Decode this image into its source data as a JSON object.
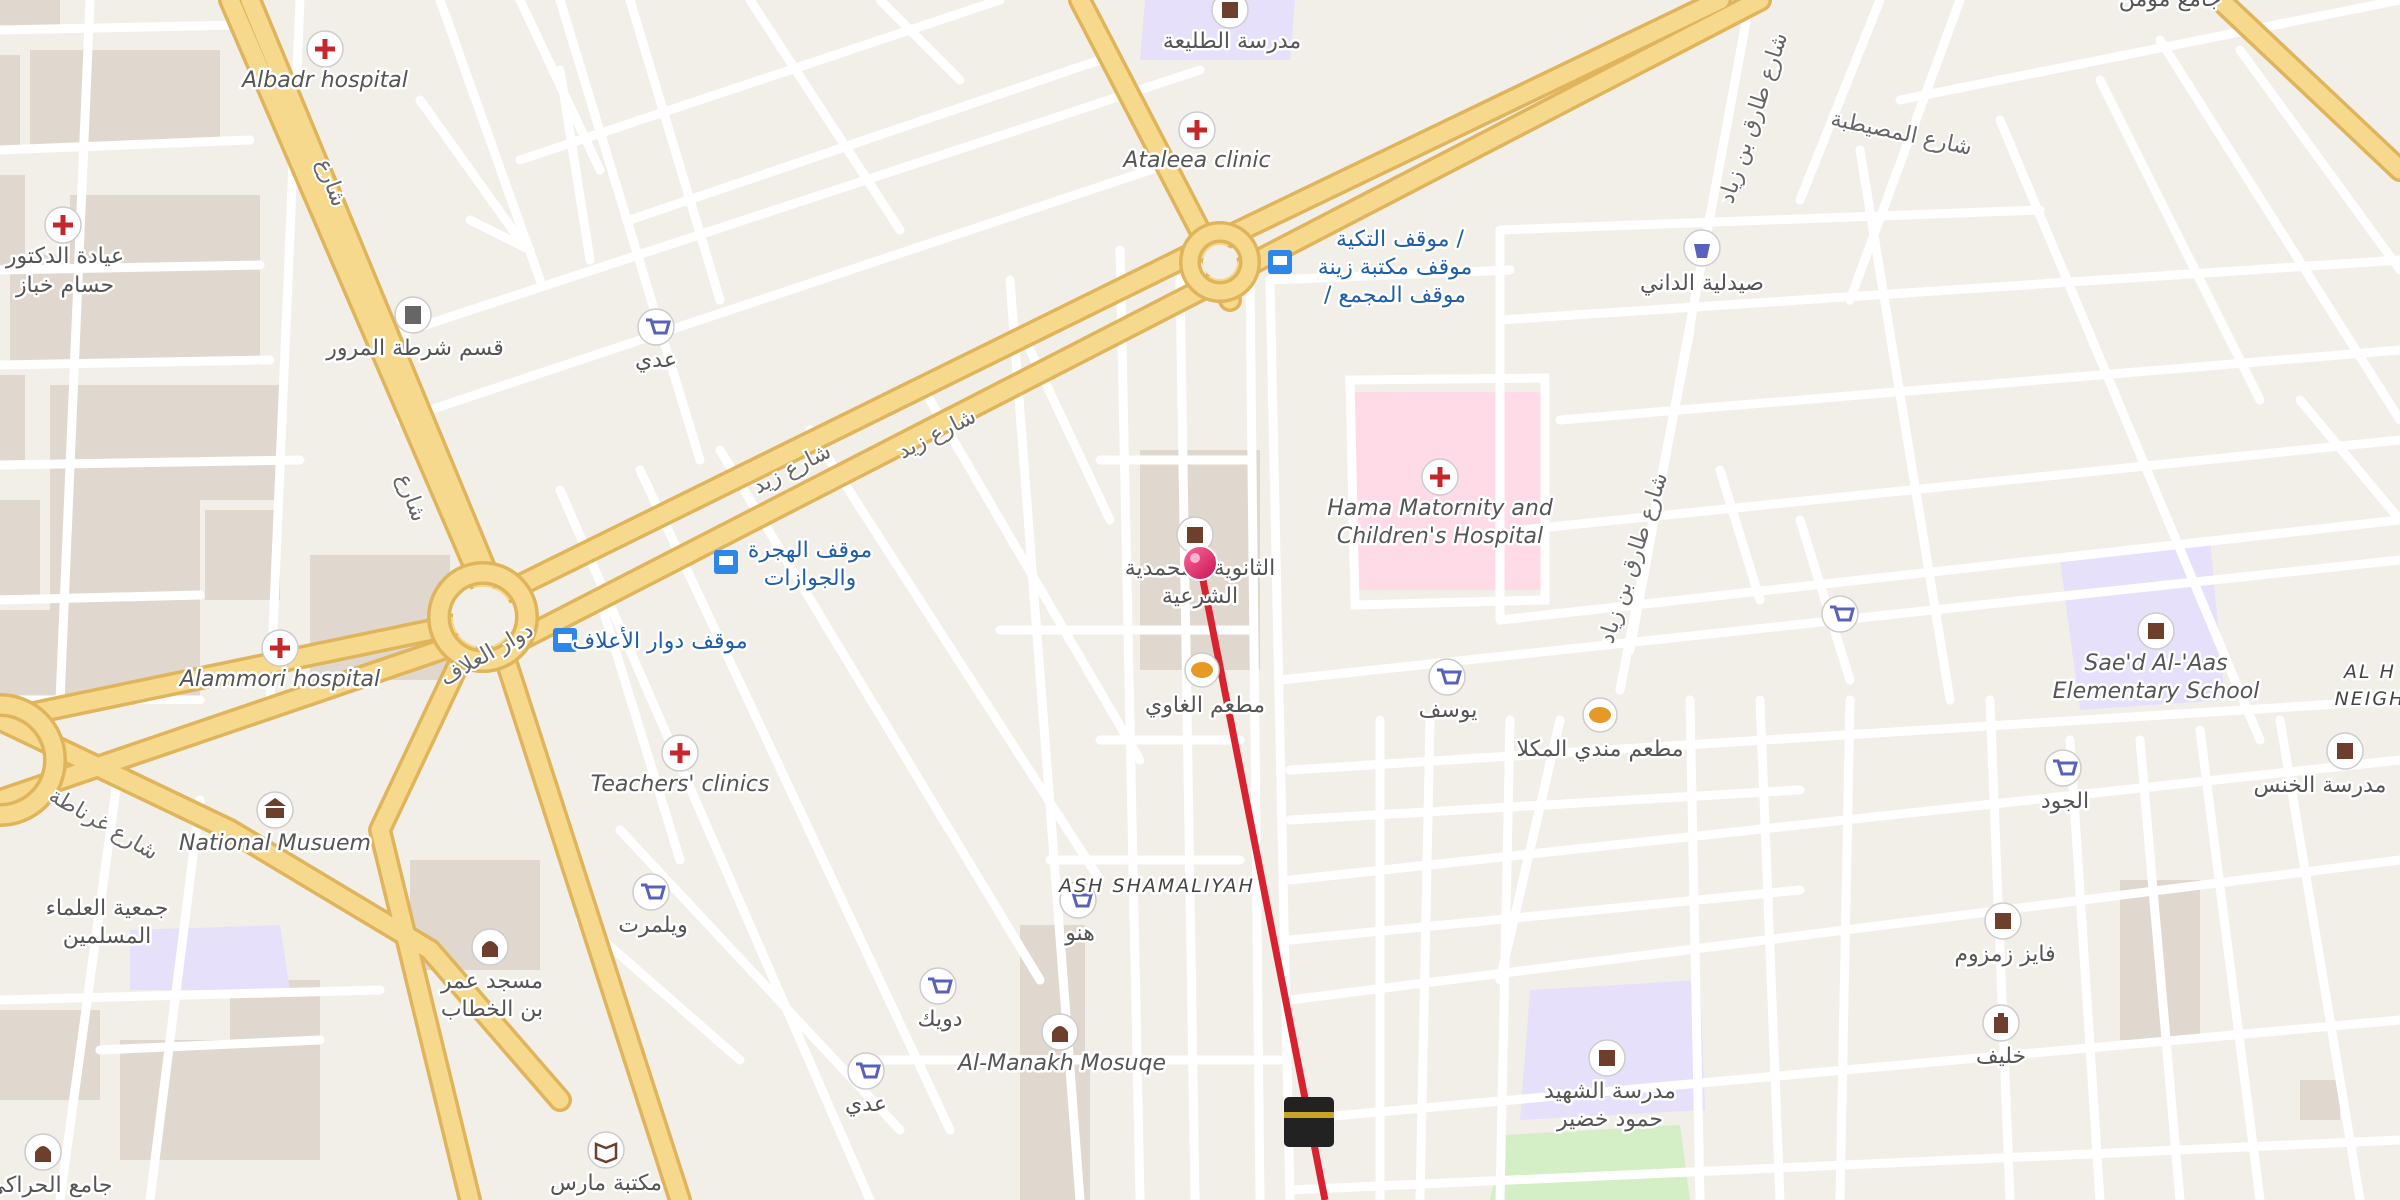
{
  "colors": {
    "land": "#f2efe9",
    "building": "#e0d8ce",
    "street": "#ffffff",
    "street_casing": "#dcd6cf",
    "major_road": "#f7d98e",
    "major_casing": "#e0b45a",
    "hospital_area": "#ffdbe8",
    "school_area": "#e6e0fb",
    "park": "#d4eec6",
    "route": "#d9222f",
    "pin": "#e91e63",
    "health_icon": "#c5282c",
    "shop_icon": "#5a61bc",
    "transit_icon": "#2d87e8",
    "food_icon": "#e69a25"
  },
  "pois": [
    {
      "icon": "hospital-cross-icon",
      "label": "Albadr hospital"
    },
    {
      "icon": "hospital-cross-icon",
      "label": "عيادة الدكتور\nحسام خباز"
    },
    {
      "icon": "police-icon",
      "label": "قسم شرطة المرور"
    },
    {
      "icon": "shop-cart-icon",
      "label": "عدي"
    },
    {
      "icon": "school-icon",
      "label": "مدرسة الطليعة"
    },
    {
      "icon": "hospital-cross-icon",
      "label": "Ataleea clinic"
    },
    {
      "icon": "bus-stop-icon",
      "label": "موقف التكية /\nموقف مكتبة زينة\n/ موقف المجمع"
    },
    {
      "icon": "pharmacy-icon",
      "label": "صيدلية الداني"
    },
    {
      "icon": "hospital-cross-icon",
      "label": "Hama Matornity and\nChildren's Hospital"
    },
    {
      "icon": "school-icon",
      "label": "الثانوية المحمدية\nالشرعية"
    },
    {
      "icon": "bus-stop-icon",
      "label": "موقف الهجرة\nوالجوازات"
    },
    {
      "icon": "bus-stop-icon",
      "label": "موقف دوار الأعلاف"
    },
    {
      "icon": "hospital-cross-icon",
      "label": "Alammori hospital"
    },
    {
      "icon": "hospital-cross-icon",
      "label": "Teachers' clinics"
    },
    {
      "icon": "museum-icon",
      "label": "National Musuem"
    },
    {
      "icon": "food-icon",
      "label": "مطعم الغاوي"
    },
    {
      "icon": "shop-cart-icon",
      "label": "يوسف"
    },
    {
      "icon": "food-icon",
      "label": "مطعم مندي المكلا"
    },
    {
      "icon": "shop-cart-icon",
      "label": ""
    },
    {
      "icon": "school-icon",
      "label": "Sae'd Al-'Aas\nElementary School"
    },
    {
      "icon": "shop-cart-icon",
      "label": "الجود"
    },
    {
      "icon": "school-icon",
      "label": "مدرسة الخنس"
    },
    {
      "icon": "shop-cart-icon",
      "label": "ويلمرت"
    },
    {
      "icon": "shop-cart-icon",
      "label": "هنو"
    },
    {
      "icon": "shop-cart-icon",
      "label": "دويك"
    },
    {
      "icon": "shop-cart-icon",
      "label": "عدي"
    },
    {
      "icon": "mosque-icon",
      "label": "Al-Manakh Mosuqe"
    },
    {
      "icon": "mosque-icon",
      "label": "مسجد عمر\nبن الخطاب"
    },
    {
      "icon": "school-icon",
      "label": "فايز زمزوم"
    },
    {
      "icon": "tower-icon",
      "label": "خليف"
    },
    {
      "icon": "school-icon",
      "label": "مدرسة الشهيد\nحمود خضير"
    },
    {
      "icon": "library-icon",
      "label": "مكتبة مارس"
    },
    {
      "icon": "mosque-icon",
      "label": "جامع الحراكي"
    },
    {
      "icon": "kaaba-icon",
      "label": ""
    }
  ],
  "text_labels": {
    "neighborhood_ash_shamaliyah": "ASH SHAMALIYAH",
    "neighborhood_al_h": "AL H",
    "neighborhood_neigh": "NEIGH",
    "org_ulama": "جمعية العلماء\nالمسلمين",
    "corner_top_right": "جامع مؤمن"
  },
  "road_names": {
    "zayd_road_1": "شارع زيد",
    "zayd_road_2": "شارع زيد",
    "ring_road": "دوار العلاف",
    "left_road_1": "شارع",
    "left_road_2": "شارع",
    "diag_road": "شارع غرناطة",
    "tariq_road_1": "شارع طارق بن زياد",
    "tariq_road_2": "شارع طارق بن زياد",
    "musaytbeh_road": "شارع المصيطبة"
  }
}
